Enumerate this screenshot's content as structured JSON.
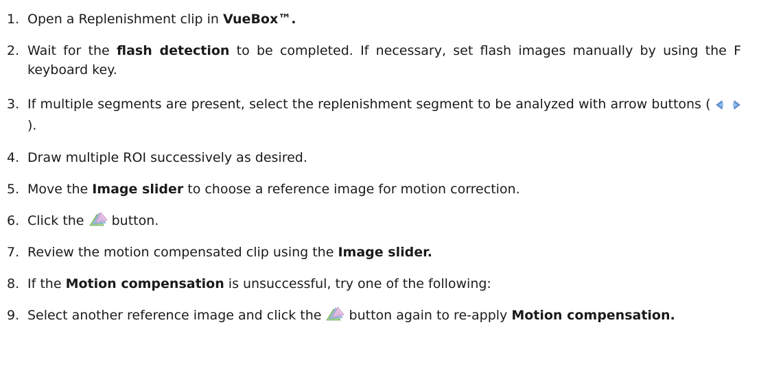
{
  "steps": [
    {
      "number": "1.",
      "parts": {
        "a": "Open a Replenishment clip in ",
        "b": "VueBox™."
      }
    },
    {
      "number": "2.",
      "parts": {
        "a": "Wait for the ",
        "b": "flash detection",
        "c": " to be completed. If necessary, set flash images manually by using the F keyboard key."
      }
    },
    {
      "number": "3.",
      "parts": {
        "a": "If multiple segments are present, select the replenishment segment to be analyzed with arrow buttons (",
        "c": ")."
      },
      "icons": [
        "arrow-left-icon",
        "arrow-right-icon"
      ]
    },
    {
      "number": "4.",
      "parts": {
        "a": "Draw multiple ROI successively as desired."
      }
    },
    {
      "number": "5.",
      "parts": {
        "a": "Move the ",
        "b": "Image slider",
        "c": " to choose a reference image for motion correction."
      }
    },
    {
      "number": "6.",
      "parts": {
        "a": "Click the ",
        "c": " button."
      },
      "icons": [
        "motion-compensation-icon"
      ]
    },
    {
      "number": "7.",
      "parts": {
        "a": "Review the motion compensated clip using the ",
        "b": "Image slider."
      }
    },
    {
      "number": "8.",
      "parts": {
        "a": "If the ",
        "b": "Motion compensation",
        "c": " is unsuccessful, try one of the following:"
      }
    },
    {
      "number": "9.",
      "parts": {
        "a": "Select another reference image and click the ",
        "c": " button again to re-apply ",
        "d": "Motion compensation."
      },
      "icons": [
        "motion-compensation-icon"
      ]
    }
  ],
  "colors": {
    "text": "#1a1a1a",
    "arrow_blue": "#5a8fd0",
    "layer_green": "#a8d890",
    "layer_blue": "#a8c8f0",
    "layer_pink": "#e8b8e0"
  }
}
